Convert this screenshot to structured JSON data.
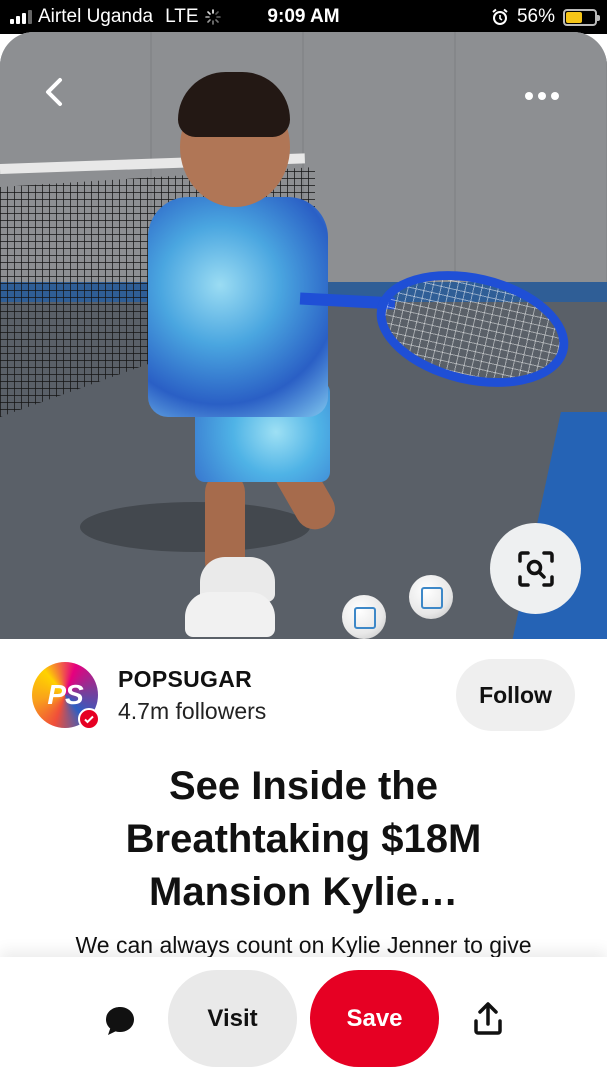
{
  "status_bar": {
    "carrier": "Airtel Uganda",
    "network": "LTE",
    "time": "9:09 AM",
    "battery_percent": "56%",
    "battery_level": 0.56,
    "icons": [
      "signal-icon",
      "loading-spinner-icon",
      "alarm-icon",
      "battery-icon"
    ]
  },
  "pin": {
    "image_icons": {
      "back": "chevron-left-icon",
      "more": "ellipsis-icon",
      "lens": "visual-search-icon"
    },
    "profile": {
      "avatar_text": "PS",
      "name": "POPSUGAR",
      "followers": "4.7m followers",
      "follow_label": "Follow"
    },
    "title": "See Inside the Breathtaking $18M Mansion Kylie…",
    "title_lines": [
      "See Inside the",
      "Breathtaking $18M",
      "Mansion Kylie…"
    ],
    "description": "We can always count on Kylie Jenner to give"
  },
  "action_bar": {
    "visit_label": "Visit",
    "save_label": "Save",
    "icons": {
      "comment": "comment-bubble-icon",
      "share": "share-upload-icon"
    }
  },
  "colors": {
    "save_red": "#e60023",
    "button_gray": "#efefef",
    "status_bar_bg": "#000000",
    "battery_yellow": "#f5c518"
  }
}
